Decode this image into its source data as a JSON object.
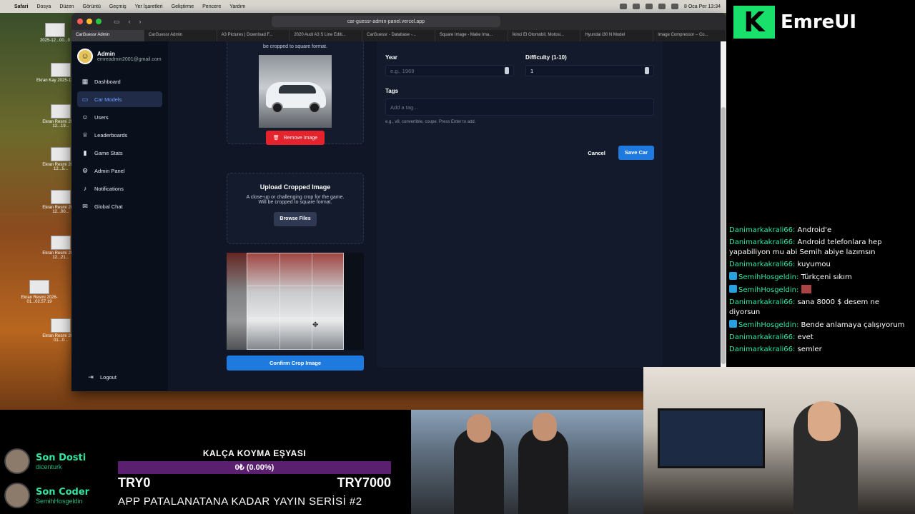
{
  "menubar": {
    "app": "Safari",
    "items": [
      "Dosya",
      "Düzen",
      "Görüntü",
      "Geçmiş",
      "Yer İşaretleri",
      "Geliştirme",
      "Pencere",
      "Yardım"
    ],
    "clock": "8 Oca Per 13:34"
  },
  "desktop": {
    "icons": [
      "2025-12...00...0",
      "Ekran Kay\n2025-12...17...",
      "Ekran Resmi\n2025-12...19...",
      "Ekran Resmi\n2025-12...5...",
      "Ekran Resmi\n2025-12...00...",
      "Ekran Resmi\n2025-12...21...",
      "Ekran Resmi\n2026-01...02.57.19",
      "Ekran Resmi\n2026-01...0..."
    ]
  },
  "browser": {
    "url": "car-guessr-admin-panel.vercel.app",
    "tabs": [
      "CarGuessr Admin",
      "CarGuessr Admin",
      "A3 Pictures | Download F...",
      "2020 Audi A3 S Line Editi...",
      "CarGuessr - Database -...",
      "Square Image - Make Ima...",
      "İkinci El Otomobil, Motosi...",
      "Hyundai i30 N Model",
      "Image Compressor – Co..."
    ]
  },
  "sidebar": {
    "name": "Admin",
    "email": "emreadmin2001@gmail.com",
    "items": [
      {
        "label": "Dashboard",
        "icon": "grid-icon"
      },
      {
        "label": "Car Models",
        "icon": "car-icon"
      },
      {
        "label": "Users",
        "icon": "users-icon"
      },
      {
        "label": "Leaderboards",
        "icon": "trophy-icon"
      },
      {
        "label": "Game Stats",
        "icon": "bar-chart-icon"
      },
      {
        "label": "Admin Panel",
        "icon": "gear-icon"
      },
      {
        "label": "Notifications",
        "icon": "bell-icon"
      },
      {
        "label": "Global Chat",
        "icon": "chat-icon"
      }
    ],
    "logout": "Logout"
  },
  "upload": {
    "note_top": "be cropped to square format.",
    "remove": "Remove Image",
    "cropped_title": "Upload Cropped Image",
    "cropped_desc1": "A close-up or challenging crop for the game.",
    "cropped_desc2": "Will be cropped to square format.",
    "browse": "Browse Files",
    "confirm": "Confirm Crop Image"
  },
  "form": {
    "year_label": "Year",
    "year_placeholder": "e.g., 1969",
    "difficulty_label": "Difficulty (1-10)",
    "difficulty_value": "1",
    "tags_label": "Tags",
    "tags_placeholder": "Add a tag...",
    "tags_hint": "e.g., v8, convertible, coupe. Press Enter to add.",
    "cancel": "Cancel",
    "save": "Save Car"
  },
  "stream": {
    "brand": "EmreUI",
    "chat": [
      {
        "user": "Danimarkakrali66:",
        "text": "Android'e",
        "badge": false
      },
      {
        "user": "Danimarkakrali66:",
        "text": "Android telefonlara hep yapabiliyon mu abi Semih abiye lazımsın",
        "badge": false
      },
      {
        "user": "Danimarkakrali66:",
        "text": "kuyumou",
        "badge": false
      },
      {
        "user": "SemihHosgeldin:",
        "text": "Türkçeni sıkım",
        "badge": true
      },
      {
        "user": "SemihHosgeldin:",
        "text": "",
        "badge": true
      },
      {
        "user": "Danimarkakrali66:",
        "text": "sana 8000 $ desem ne diyorsun",
        "badge": false
      },
      {
        "user": "SemihHosgeldin:",
        "text": "Bende anlamaya çalışıyorum",
        "badge": true
      },
      {
        "user": "Danimarkakrali66:",
        "text": "evet",
        "badge": false
      },
      {
        "user": "Danimarkakrali66:",
        "text": "semler",
        "badge": false
      }
    ],
    "latest_donor_title": "Son Dosti",
    "latest_donor_name": "dicenturk",
    "latest_coder_title": "Son Coder",
    "latest_coder_name": "SemihHosgeldin",
    "goal_title": "KALÇA KOYMA EŞYASI",
    "goal_progress": "0₺ (0.00%)",
    "goal_min": "TRY0",
    "goal_max": "TRY7000",
    "series": "APP PATALANATANA KADAR YAYIN SERİSİ #2"
  }
}
